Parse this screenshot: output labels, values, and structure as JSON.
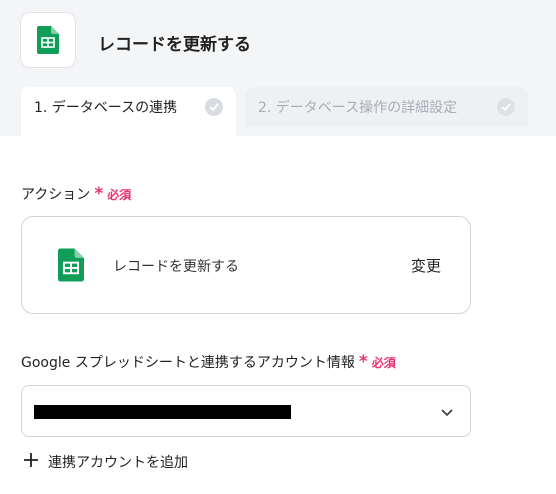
{
  "header": {
    "title": "レコードを更新する"
  },
  "tabs": [
    {
      "label": "1. データベースの連携",
      "active": true
    },
    {
      "label": "2. データベース操作の詳細設定",
      "active": false
    }
  ],
  "action_section": {
    "label": "アクション",
    "required_mark": "*",
    "required_text": "必須",
    "action_name": "レコードを更新する",
    "change_label": "変更"
  },
  "account_section": {
    "label": "Google スプレッドシートと連携するアカウント情報",
    "required_mark": "*",
    "required_text": "必須",
    "add_account_label": "連携アカウントを追加"
  },
  "colors": {
    "accent_required": "#e8336d",
    "sheets_green": "#0f9d58"
  },
  "icons": [
    "google-sheets-icon",
    "check-icon",
    "chevron-down-icon",
    "plus-icon"
  ]
}
